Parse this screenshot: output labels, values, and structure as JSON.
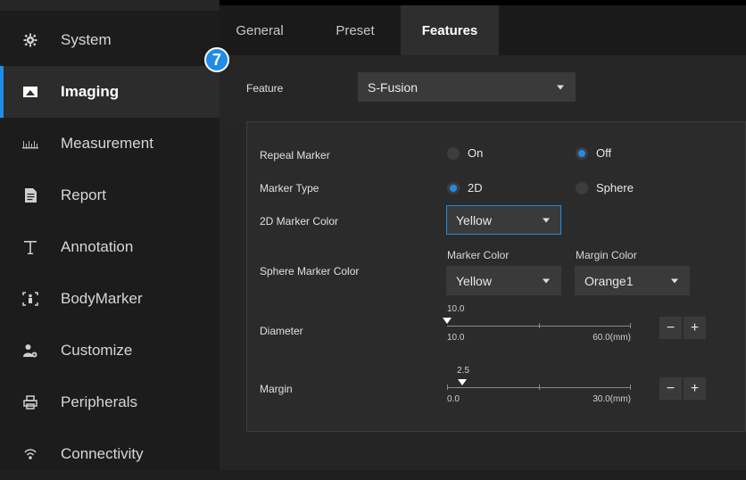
{
  "sidebar": {
    "items": [
      {
        "label": "System",
        "icon": "gear-icon"
      },
      {
        "label": "Imaging",
        "icon": "monitor-icon"
      },
      {
        "label": "Measurement",
        "icon": "ruler-icon"
      },
      {
        "label": "Report",
        "icon": "document-icon"
      },
      {
        "label": "Annotation",
        "icon": "text-icon"
      },
      {
        "label": "BodyMarker",
        "icon": "body-marker-icon"
      },
      {
        "label": "Customize",
        "icon": "user-settings-icon"
      },
      {
        "label": "Peripherals",
        "icon": "printer-icon"
      },
      {
        "label": "Connectivity",
        "icon": "network-icon"
      }
    ],
    "active": "Imaging"
  },
  "tabs": [
    {
      "label": "General"
    },
    {
      "label": "Preset"
    },
    {
      "label": "Features"
    }
  ],
  "active_tab": "Features",
  "callout_number": "7",
  "feature": {
    "label": "Feature",
    "value": "S-Fusion"
  },
  "panel": {
    "repeal_marker": {
      "label": "Repeal Marker",
      "options": [
        "On",
        "Off"
      ],
      "selected": "Off"
    },
    "marker_type": {
      "label": "Marker Type",
      "options": [
        "2D",
        "Sphere"
      ],
      "selected": "2D"
    },
    "marker_color_2d": {
      "label": "2D Marker Color",
      "value": "Yellow"
    },
    "sphere_marker_color": {
      "label": "Sphere Marker Color",
      "marker_color_header": "Marker Color",
      "marker_color_value": "Yellow",
      "margin_color_header": "Margin Color",
      "margin_color_value": "Orange1"
    },
    "diameter": {
      "label": "Diameter",
      "value": "10.0",
      "value_num": 10.0,
      "min": "10.0",
      "min_num": 10.0,
      "max": "60.0(mm)",
      "max_num": 60.0
    },
    "margin": {
      "label": "Margin",
      "value": "2.5",
      "value_num": 2.5,
      "min": "0.0",
      "min_num": 0.0,
      "max": "30.0(mm)",
      "max_num": 30.0
    },
    "minus_label": "−",
    "plus_label": "+"
  },
  "colors": {
    "accent": "#1f8ce6",
    "sidebar_bg": "#1c1c1c",
    "panel_bg": "#2b2b2b"
  }
}
